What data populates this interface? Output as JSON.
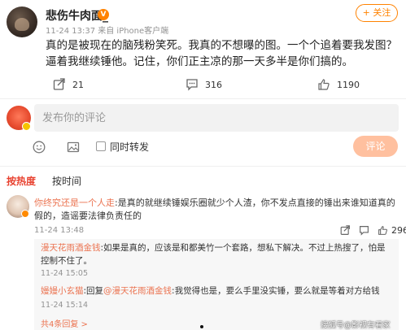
{
  "post": {
    "author": "悲伤牛肉面_",
    "meta": "11-24 13:37  来自 iPhone客户端",
    "follow_label": "+ 关注",
    "text": "真的是被现在的脑残粉笑死。我真的不想曝的图。一个个追着要我发图？逼着我继续锤他。记住，你们正主凉的那一天多半是你们搞的。",
    "reposts": "21",
    "comments": "316",
    "likes": "1190"
  },
  "composer": {
    "placeholder": "发布你的评论",
    "repost_label": "同时转发",
    "submit_label": "评论"
  },
  "tabs": {
    "hot": "按热度",
    "time": "按时间"
  },
  "comment": {
    "user": "你终究还是一个人走",
    "text": ":是真的就继续锤娱乐圈就少个人渣，你不发点直接的锤出来谁知道真的假的，造谣要法律负责任的",
    "time": "11-24 13:48",
    "likes": "296"
  },
  "replies": [
    {
      "user": "漫天花雨酒金钱",
      "text": ":如果是真的，应该是和都美竹一个套路，想私下解决。不过上热搜了，怕是控制不住了。",
      "time": "11-24 15:05"
    },
    {
      "user": "嫚嫚小玄猫",
      "reply_prefix": ":回复",
      "reply_to": "@漫天花雨酒金钱",
      "text": ":我觉得也是，要么手里没实锤，要么就是等着对方给钱",
      "time": "11-24 15:14"
    }
  ],
  "replies_more": "共4条回复 >",
  "watermark": "搜狐号@影视有看家",
  "colors": {
    "accent": "#ff8200",
    "username": "#eb7350",
    "hot_tab": "#e8402e",
    "submit_disabled": "#ffc09f"
  },
  "icons": {
    "repost": "repost-icon",
    "comment": "comment-icon",
    "like": "thumbs-up-icon",
    "emoji": "emoji-icon",
    "image": "image-icon",
    "share": "share-icon"
  }
}
